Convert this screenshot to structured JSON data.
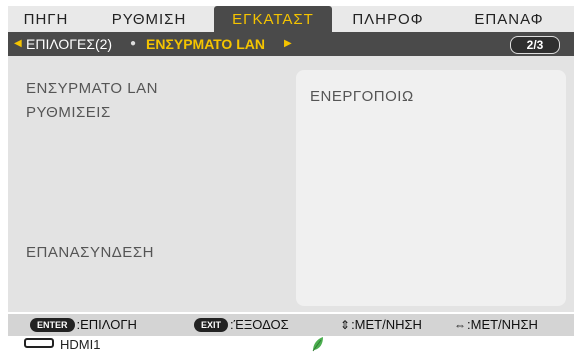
{
  "tabs": [
    {
      "label": "ΠΗΓΗ"
    },
    {
      "label": "ΡΥΘΜΙΣΗ"
    },
    {
      "label": "ΕΓΚΑΤΑΣΤ"
    },
    {
      "label": "ΠΛΗΡΟΦ"
    },
    {
      "label": "ΕΠΑΝΑΦ"
    }
  ],
  "subnav": {
    "prev_label": "ΕΠΙΛΟΓΕΣ(2)",
    "current_label": "ΕΝΣΥΡΜΑΤΟ LAN",
    "page": "2/3"
  },
  "panel": {
    "wired_lan_label": "ΕΝΣΥΡΜΑΤΟ LAN",
    "settings_label": "ΡΥΘΜΙΣΕΙΣ",
    "reconnect_label": "ΕΠΑΝΑΣΥΝΔΕΣΗ",
    "wired_lan_value": "ΕΝΕΡΓΟΠΟΙΩ"
  },
  "footer": {
    "enter_key": "ENTER",
    "enter_action": ":ΕΠΙΛΟΓΗ",
    "exit_key": "EXIT",
    "exit_action": ":ΈΞΟΔΟΣ",
    "updown_action": ":ΜΕΤ/ΝΗΣΗ",
    "leftright_action": ":ΜΕΤ/ΝΗΣΗ"
  },
  "status": {
    "source": "HDMI1",
    "eco_icon": "leaf-icon"
  },
  "colors": {
    "accent": "#f5c400",
    "eco": "#4caf50"
  }
}
